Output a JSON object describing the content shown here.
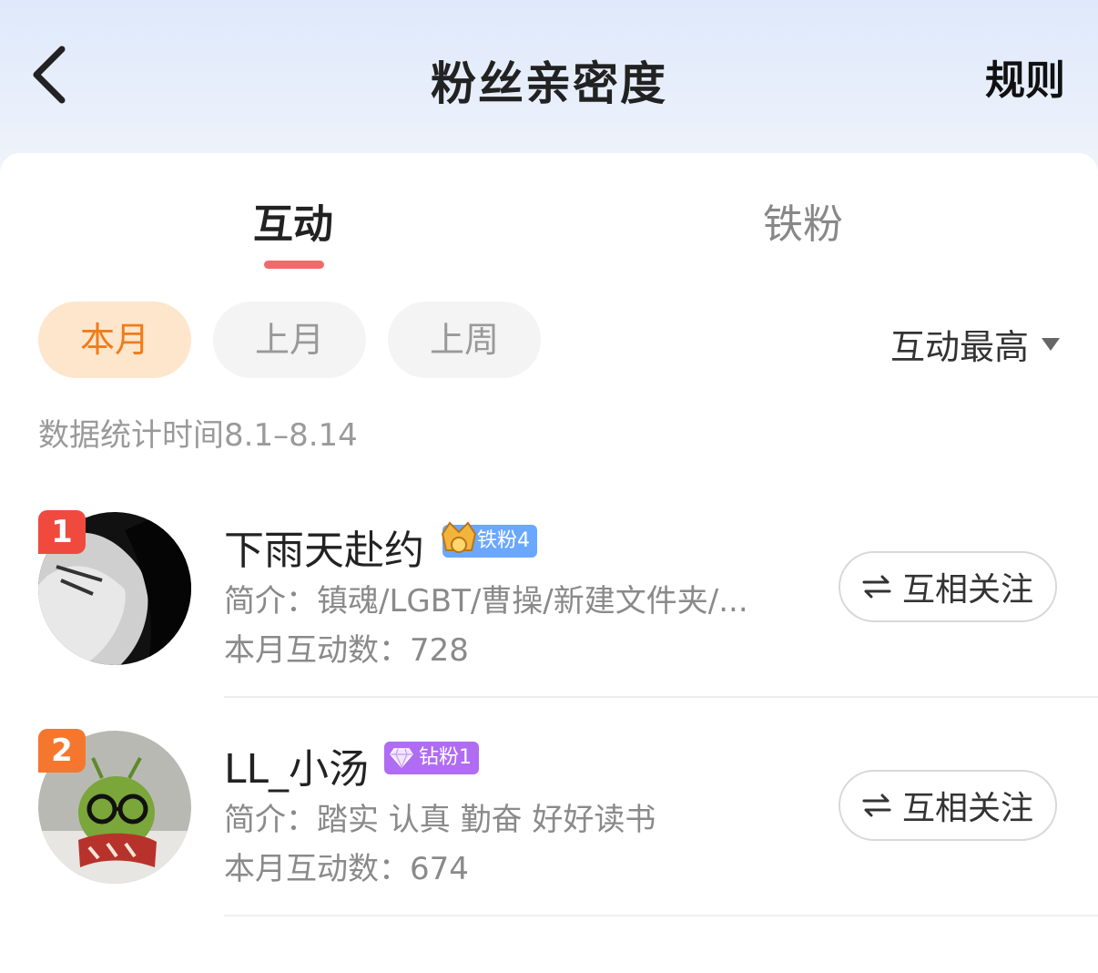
{
  "header": {
    "title": "粉丝亲密度",
    "rules_label": "规则"
  },
  "tabs": [
    {
      "label": "互动",
      "active": true
    },
    {
      "label": "铁粉",
      "active": false
    }
  ],
  "filters": {
    "options": [
      "本月",
      "上月",
      "上周"
    ],
    "selected": "本月",
    "sort_label": "互动最高"
  },
  "stat_period": "数据统计时间8.1–8.14",
  "fans": [
    {
      "rank": "1",
      "rank_color": "#f04a3f",
      "name": "下雨天赴约",
      "badge": {
        "text": "铁粉4",
        "color": "#6aa8ff",
        "icon": "crown-icon"
      },
      "bio": "简介：镇魂/LGBT/曹操/新建文件夹/...",
      "count": "本月互动数：728",
      "follow_label": "互相关注"
    },
    {
      "rank": "2",
      "rank_color": "#f5772e",
      "name": "LL_小汤",
      "badge": {
        "text": "钻粉1",
        "color": "#b06cf2",
        "icon": "diamond-icon"
      },
      "bio": "简介：踏实 认真 勤奋 好好读书",
      "count": "本月互动数：674",
      "follow_label": "互相关注"
    }
  ]
}
